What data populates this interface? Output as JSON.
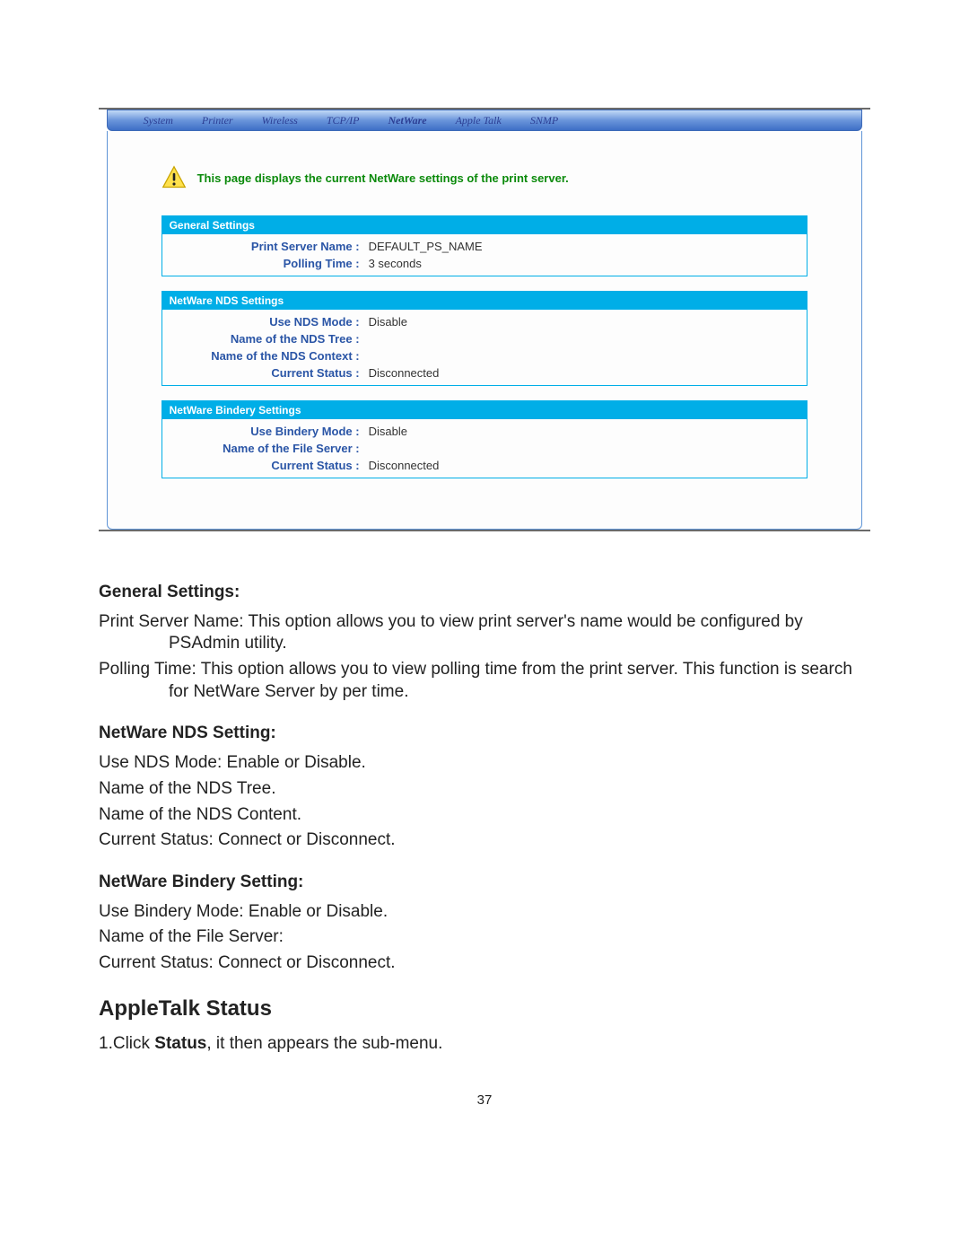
{
  "nav": {
    "tabs": [
      "System",
      "Printer",
      "Wireless",
      "TCP/IP",
      "NetWare",
      "Apple Talk",
      "SNMP"
    ],
    "active": "NetWare"
  },
  "intro": "This page displays the current NetWare settings of the print server.",
  "groups": [
    {
      "title": "General Settings",
      "rows": [
        {
          "label": "Print Server Name :",
          "value": "DEFAULT_PS_NAME"
        },
        {
          "label": "Polling Time :",
          "value": "3 seconds"
        }
      ]
    },
    {
      "title": "NetWare NDS Settings",
      "rows": [
        {
          "label": "Use NDS Mode :",
          "value": "Disable"
        },
        {
          "label": "Name of the NDS Tree :",
          "value": ""
        },
        {
          "label": "Name of the NDS Context :",
          "value": ""
        },
        {
          "label": "Current Status :",
          "value": "Disconnected"
        }
      ]
    },
    {
      "title": "NetWare Bindery Settings",
      "rows": [
        {
          "label": "Use Bindery Mode :",
          "value": "Disable"
        },
        {
          "label": "Name of the File Server :",
          "value": ""
        },
        {
          "label": "Current Status :",
          "value": "Disconnected"
        }
      ]
    }
  ],
  "doc": {
    "h_general": "General Settings:",
    "general_p1": "Print Server Name: This option allows you to view print server's name would be configured by PSAdmin utility.",
    "general_p2": "Polling Time: This option allows you to view polling time from the print server. This function is search for NetWare Server by per time.",
    "h_nds": "NetWare NDS Setting:",
    "nds_l1": "Use NDS Mode: Enable or Disable.",
    "nds_l2": "Name of the NDS Tree.",
    "nds_l3": "Name of the NDS Content.",
    "nds_l4": "Current Status: Connect or Disconnect.",
    "h_bindery": "NetWare Bindery Setting:",
    "bin_l1": "Use Bindery Mode: Enable or Disable.",
    "bin_l2": "Name of the File Server:",
    "bin_l3": "Current Status: Connect or Disconnect.",
    "h_apple": "AppleTalk Status",
    "apple_step_pre": "1.Click ",
    "apple_step_bold": "Status",
    "apple_step_post": ", it then appears the sub-menu."
  },
  "page_number": "37"
}
